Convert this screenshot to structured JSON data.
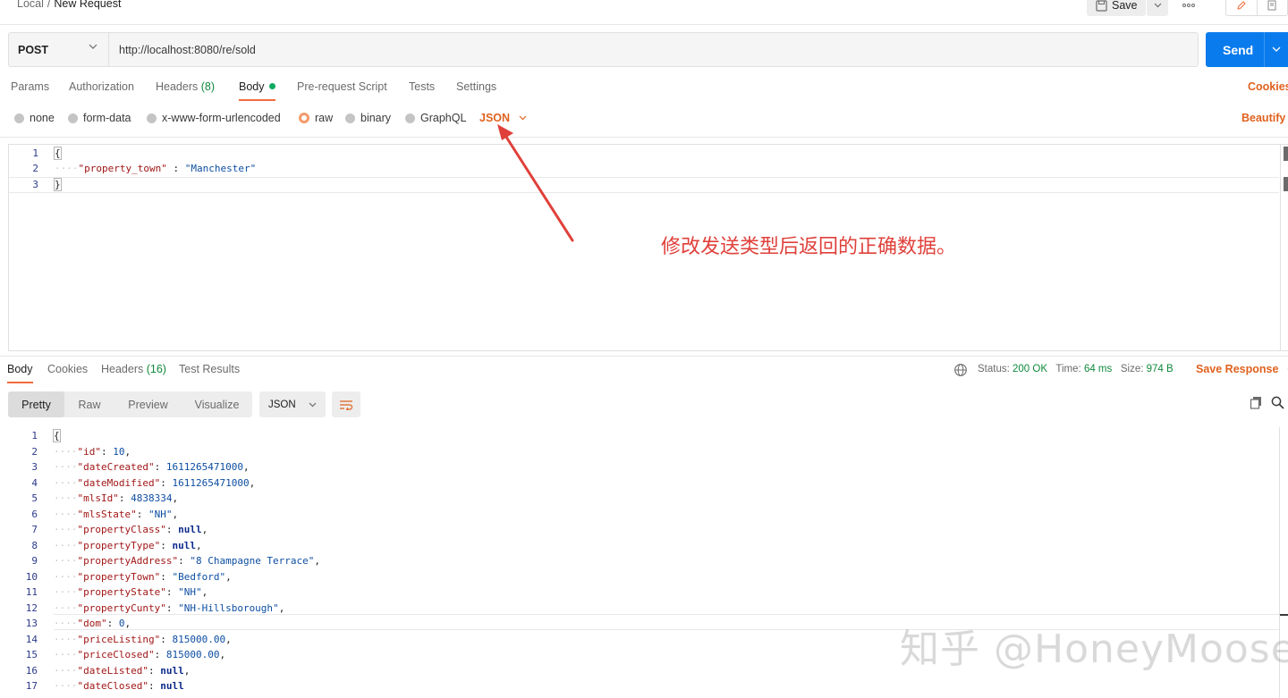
{
  "breadcrumb": {
    "parent": "Local",
    "separator": "/",
    "current": "New Request"
  },
  "toolbar": {
    "save_label": "Save"
  },
  "request": {
    "method": "POST",
    "url": "http://localhost:8080/re/sold",
    "send_label": "Send"
  },
  "request_tabs": {
    "params": "Params",
    "authorization": "Authorization",
    "headers": "Headers",
    "headers_count": "(8)",
    "body": "Body",
    "pre_request": "Pre-request Script",
    "tests": "Tests",
    "settings": "Settings",
    "cookies": "Cookies",
    "active": "Body"
  },
  "body_types": {
    "none": "none",
    "form_data": "form-data",
    "urlencoded": "x-www-form-urlencoded",
    "raw": "raw",
    "binary": "binary",
    "graphql": "GraphQL",
    "selected": "raw",
    "format": "JSON",
    "beautify": "Beautify"
  },
  "request_body": {
    "lines": [
      "1",
      "2",
      "3"
    ],
    "open": "{",
    "key": "\"property_town\"",
    "colon": " : ",
    "value": "\"Manchester\"",
    "close": "}"
  },
  "annotation": "修改发送类型后返回的正确数据。",
  "response_tabs": {
    "body": "Body",
    "cookies": "Cookies",
    "headers": "Headers",
    "headers_count": "(16)",
    "test_results": "Test Results",
    "active": "Body"
  },
  "response_status": {
    "status_label": "Status:",
    "status_value": "200 OK",
    "time_label": "Time:",
    "time_value": "64 ms",
    "size_label": "Size:",
    "size_value": "974 B",
    "save_response": "Save Response"
  },
  "response_view": {
    "pretty": "Pretty",
    "raw": "Raw",
    "preview": "Preview",
    "visualize": "Visualize",
    "active": "Pretty",
    "format": "JSON"
  },
  "response_body": [
    {
      "n": "1",
      "key": "",
      "value": "",
      "type": "open"
    },
    {
      "n": "2",
      "key": "\"id\"",
      "value": "10",
      "type": "num"
    },
    {
      "n": "3",
      "key": "\"dateCreated\"",
      "value": "1611265471000",
      "type": "num"
    },
    {
      "n": "4",
      "key": "\"dateModified\"",
      "value": "1611265471000",
      "type": "num"
    },
    {
      "n": "5",
      "key": "\"mlsId\"",
      "value": "4838334",
      "type": "num"
    },
    {
      "n": "6",
      "key": "\"mlsState\"",
      "value": "\"NH\"",
      "type": "str"
    },
    {
      "n": "7",
      "key": "\"propertyClass\"",
      "value": "null",
      "type": "null"
    },
    {
      "n": "8",
      "key": "\"propertyType\"",
      "value": "null",
      "type": "null"
    },
    {
      "n": "9",
      "key": "\"propertyAddress\"",
      "value": "\"8 Champagne Terrace\"",
      "type": "str"
    },
    {
      "n": "10",
      "key": "\"propertyTown\"",
      "value": "\"Bedford\"",
      "type": "str"
    },
    {
      "n": "11",
      "key": "\"propertyState\"",
      "value": "\"NH\"",
      "type": "str"
    },
    {
      "n": "12",
      "key": "\"propertyCunty\"",
      "value": "\"NH-Hillsborough\"",
      "type": "str"
    },
    {
      "n": "13",
      "key": "\"dom\"",
      "value": "0",
      "type": "num"
    },
    {
      "n": "14",
      "key": "\"priceListing\"",
      "value": "815000.00",
      "type": "num"
    },
    {
      "n": "15",
      "key": "\"priceClosed\"",
      "value": "815000.00",
      "type": "num"
    },
    {
      "n": "16",
      "key": "\"dateListed\"",
      "value": "null",
      "type": "null"
    },
    {
      "n": "17",
      "key": "\"dateClosed\"",
      "value": "null",
      "type": "null",
      "last": true
    }
  ],
  "watermark": "知乎 @HoneyMoose",
  "colors": {
    "accent": "#f26b3a",
    "send": "#097bed",
    "status_ok": "#0f8a3c",
    "annotation": "#e0403a"
  }
}
